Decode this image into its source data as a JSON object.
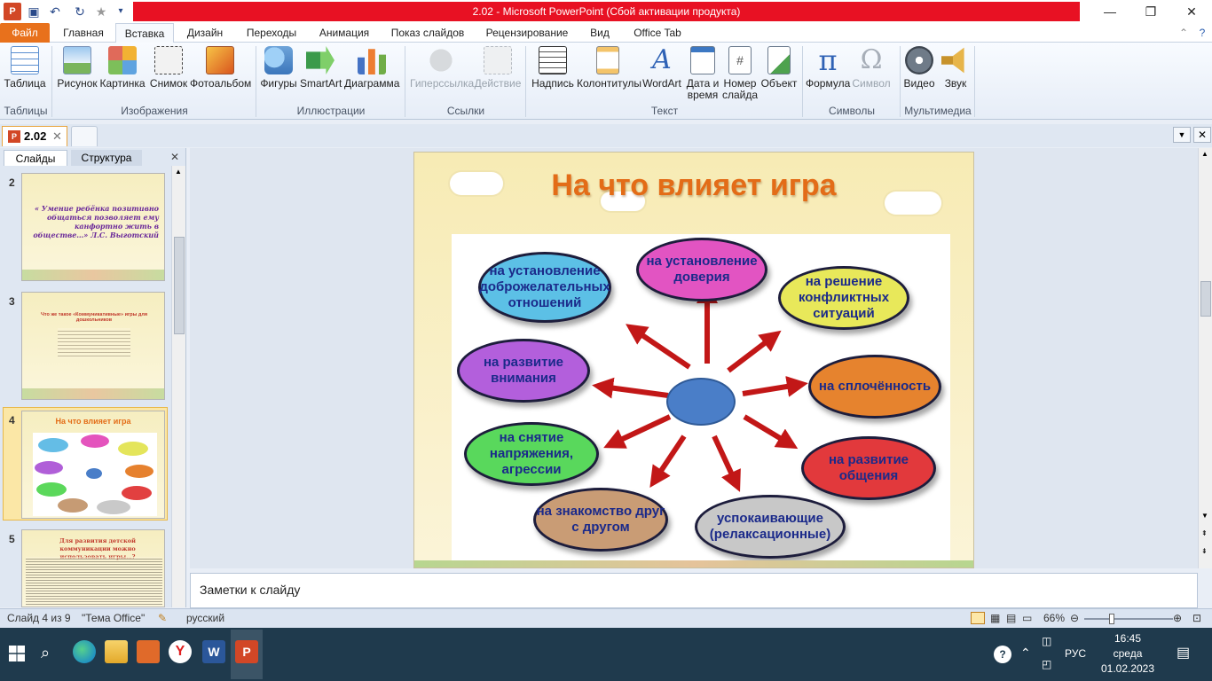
{
  "window": {
    "title": "2.02  -  Microsoft PowerPoint (Сбой активации продукта)",
    "app_icon": "powerpoint-icon"
  },
  "quick_access": [
    "save-icon",
    "undo-icon",
    "redo-icon",
    "favorite-icon",
    "customize-icon"
  ],
  "menu_tabs": [
    "Файл",
    "Главная",
    "Вставка",
    "Дизайн",
    "Переходы",
    "Анимация",
    "Показ слайдов",
    "Рецензирование",
    "Вид",
    "Office Tab"
  ],
  "active_tab": "Вставка",
  "ribbon": {
    "groups": [
      {
        "label": "Таблицы",
        "buttons": [
          "Таблица"
        ]
      },
      {
        "label": "Изображения",
        "buttons": [
          "Рисунок",
          "Картинка",
          "Снимок",
          "Фотоальбом"
        ]
      },
      {
        "label": "Иллюстрации",
        "buttons": [
          "Фигуры",
          "SmartArt",
          "Диаграмма"
        ]
      },
      {
        "label": "Ссылки",
        "buttons": [
          "Гиперссылка",
          "Действие"
        ]
      },
      {
        "label": "Текст",
        "buttons": [
          "Надпись",
          "Колонтитулы",
          "WordArt",
          "Дата и",
          "время",
          "Номер",
          "слайда",
          "Объект"
        ]
      },
      {
        "label": "Символы",
        "buttons": [
          "Формула",
          "Символ"
        ]
      },
      {
        "label": "Мультимедиа",
        "buttons": [
          "Видео",
          "Звук"
        ]
      }
    ]
  },
  "doc_tab": {
    "name": "2.02"
  },
  "left_panel": {
    "tabs": [
      "Слайды",
      "Структура"
    ],
    "slides": [
      {
        "num": "2",
        "text": "« Умение ребёнка позитивно общаться позволяет ему канфортно жить в обществе…» Л.С. Выготский"
      },
      {
        "num": "3",
        "text": "Что же такое «Коммуникативные» игры для дошкольников"
      },
      {
        "num": "4",
        "text": "На что влияет игра"
      },
      {
        "num": "5",
        "text": "Для развития детской коммуникации можно использовать игры…?"
      }
    ]
  },
  "slide": {
    "title": "На что влияет игра",
    "ovals": [
      "на установление доброжелательных отношений",
      "на установление доверия",
      "на решение конфликтных ситуаций",
      "на развитие внимания",
      "на сплочённость",
      "на снятие напряжения, агрессии",
      "на развитие общения",
      "на знакомство друг с другом",
      "успокаивающие (релаксационные)"
    ]
  },
  "notes_placeholder": "Заметки к слайду",
  "status": {
    "slide_info": "Слайд 4 из 9",
    "theme": "\"Тема Office\"",
    "language": "русский",
    "zoom": "66%"
  },
  "taskbar": {
    "language": "РУС",
    "time": "16:45",
    "day": "среда",
    "date": "01.02.2023"
  }
}
